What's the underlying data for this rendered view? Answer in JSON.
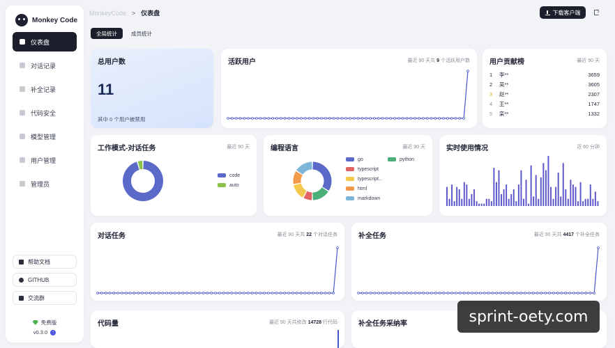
{
  "brand": {
    "name": "Monkey Code"
  },
  "sidebar": {
    "items": [
      {
        "label": "仪表盘",
        "icon": "dashboard-icon",
        "active": true
      },
      {
        "label": "对话记录",
        "icon": "chat-icon"
      },
      {
        "label": "补全记录",
        "icon": "completion-icon"
      },
      {
        "label": "代码安全",
        "icon": "shield-icon"
      },
      {
        "label": "模型管理",
        "icon": "model-icon"
      },
      {
        "label": "用户管理",
        "icon": "user-icon"
      },
      {
        "label": "管理员",
        "icon": "admin-icon"
      }
    ],
    "links": [
      {
        "label": "帮助文档",
        "icon": "doc-icon"
      },
      {
        "label": "GITHUB",
        "icon": "github-icon"
      },
      {
        "label": "交流群",
        "icon": "group-icon"
      }
    ],
    "plan": "免费版",
    "version": "v0.3.0"
  },
  "header": {
    "breadcrumb_root": "MonkeyCode",
    "breadcrumb_sep": ">",
    "breadcrumb_current": "仪表盘",
    "download_label": "下载客户端"
  },
  "tabs": [
    {
      "label": "全局统计",
      "active": true
    },
    {
      "label": "成员统计",
      "active": false
    }
  ],
  "cards": {
    "total_users": {
      "title": "总用户数",
      "value": "11",
      "sub": "其中 0 个用户被禁用"
    },
    "active_users": {
      "title": "活跃用户",
      "meta_prefix": "最近 90 天共",
      "meta_value": "9",
      "meta_suffix": "个活跃用户数"
    },
    "leaderboard": {
      "title": "用户贡献榜",
      "meta": "最近 90 天",
      "rows": [
        {
          "rank": "1",
          "name": "李**",
          "value": "3659"
        },
        {
          "rank": "2",
          "name": "吴**",
          "value": "3605"
        },
        {
          "rank": "3",
          "name": "赵**",
          "value": "2307"
        },
        {
          "rank": "4",
          "name": "王**",
          "value": "1747"
        },
        {
          "rank": "5",
          "name": "栾**",
          "value": "1332"
        }
      ]
    },
    "work_mode": {
      "title": "工作模式-对话任务",
      "meta": "最近 90 天"
    },
    "languages": {
      "title": "编程语言",
      "meta": "最近 90 天"
    },
    "realtime": {
      "title": "实时使用情况",
      "meta": "近 60 分钟"
    },
    "chat_tasks": {
      "title": "对话任务",
      "meta_prefix": "最近 90 天共",
      "meta_value": "22",
      "meta_suffix": "个对话任务"
    },
    "completion_tasks": {
      "title": "补全任务",
      "meta_prefix": "最近 90 天共",
      "meta_value": "4417",
      "meta_suffix": "个补全任务"
    },
    "code_volume": {
      "title": "代码量",
      "meta_prefix": "最近 90 天共修改",
      "meta_value": "14728",
      "meta_suffix": "行代码"
    },
    "acceptance": {
      "title": "补全任务采纳率"
    }
  },
  "watermark": "sprint-oety.com",
  "colors": {
    "accent": "#4a56c8",
    "sidebar_active": "#1c1f2b",
    "users_card": "#dbe6fb",
    "go": "#5b6ac9",
    "python": "#4caf7a",
    "typescript": "#e06464",
    "typescript_other": "#f2c94c",
    "html": "#f2994a",
    "markdown": "#7fb5d8",
    "code": "#5b6ac9",
    "auto": "#8bc34a"
  },
  "chart_data": [
    {
      "id": "active_users",
      "type": "line",
      "points": 60,
      "values_note": "zeros except final spike",
      "x": [],
      "series": [
        {
          "values": [
            0,
            0,
            0,
            0,
            0,
            0,
            0,
            0,
            0,
            0,
            0,
            0,
            0,
            0,
            0,
            0,
            0,
            0,
            0,
            0,
            0,
            0,
            0,
            0,
            0,
            0,
            0,
            0,
            0,
            0,
            0,
            0,
            0,
            0,
            0,
            0,
            0,
            0,
            0,
            0,
            0,
            0,
            0,
            0,
            0,
            0,
            0,
            0,
            0,
            0,
            0,
            0,
            0,
            0,
            0,
            0,
            0,
            0,
            0,
            9
          ]
        }
      ]
    },
    {
      "id": "work_mode",
      "type": "pie",
      "labels": [
        "code",
        "auto"
      ],
      "values": [
        21,
        1
      ]
    },
    {
      "id": "languages",
      "type": "pie",
      "labels": [
        "go",
        "python",
        "typescript",
        "typescript...",
        "html",
        "markdown"
      ],
      "values": [
        34,
        16,
        8,
        14,
        12,
        16
      ]
    },
    {
      "id": "realtime",
      "type": "bar",
      "values": [
        8,
        3,
        9,
        2,
        8,
        7,
        3,
        10,
        9,
        3,
        5,
        7,
        2,
        1,
        1,
        1,
        3,
        3,
        2,
        16,
        10,
        15,
        5,
        7,
        9,
        3,
        5,
        7,
        2,
        9,
        15,
        3,
        11,
        1,
        17,
        4,
        13,
        3,
        12,
        18,
        15,
        21,
        8,
        3,
        8,
        14,
        4,
        18,
        7,
        3,
        11,
        9,
        8,
        2,
        10,
        2,
        3,
        3,
        9,
        3,
        6,
        2
      ]
    },
    {
      "id": "chat_tasks",
      "type": "line",
      "series": [
        {
          "values": [
            0,
            0,
            0,
            0,
            0,
            0,
            0,
            0,
            0,
            0,
            0,
            0,
            0,
            0,
            0,
            0,
            0,
            0,
            0,
            0,
            0,
            0,
            0,
            0,
            0,
            0,
            0,
            0,
            0,
            0,
            0,
            0,
            0,
            0,
            0,
            0,
            0,
            0,
            0,
            0,
            0,
            0,
            0,
            0,
            0,
            0,
            0,
            0,
            0,
            0,
            0,
            0,
            0,
            0,
            0,
            0,
            0,
            0,
            0,
            22
          ]
        }
      ]
    },
    {
      "id": "completion_tasks",
      "type": "line",
      "series": [
        {
          "values": [
            0,
            0,
            0,
            0,
            0,
            0,
            0,
            0,
            0,
            0,
            0,
            0,
            0,
            0,
            0,
            0,
            0,
            0,
            0,
            0,
            0,
            0,
            0,
            0,
            0,
            0,
            0,
            0,
            0,
            0,
            0,
            0,
            0,
            0,
            0,
            0,
            0,
            0,
            0,
            0,
            0,
            0,
            0,
            0,
            0,
            0,
            0,
            0,
            0,
            0,
            0,
            0,
            0,
            0,
            0,
            0,
            0,
            0,
            0,
            4417
          ]
        }
      ]
    }
  ]
}
